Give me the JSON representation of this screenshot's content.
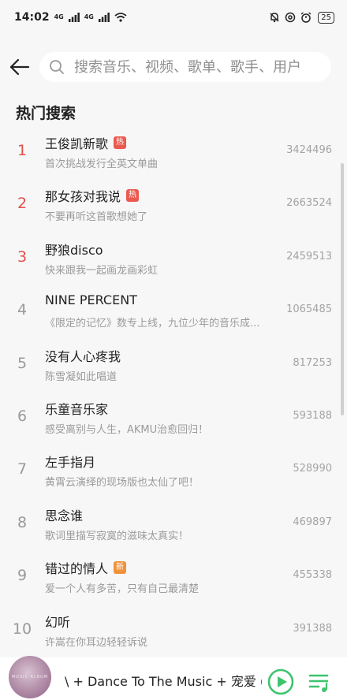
{
  "status_bar": {
    "time": "14:02",
    "signal1": "4G",
    "signal2": "4G",
    "battery": "25"
  },
  "search": {
    "placeholder": "搜索音乐、视频、歌单、歌手、用户"
  },
  "section_title": "热门搜索",
  "colors": {
    "accent": "#e0524a",
    "hot_badge": "#ea5a4f",
    "new_badge": "#f0923a",
    "play_green": "#3ec46d"
  },
  "hot_list": [
    {
      "rank": "1",
      "title": "王俊凯新歌",
      "badge": "热",
      "badge_type": "hot",
      "desc": "首次挑战发行全英文单曲",
      "count": "3424496"
    },
    {
      "rank": "2",
      "title": "那女孩对我说",
      "badge": "热",
      "badge_type": "hot",
      "desc": "不要再听这首歌想她了",
      "count": "2663524"
    },
    {
      "rank": "3",
      "title": "野狼disco",
      "badge": "",
      "badge_type": "",
      "desc": "快来跟我一起画龙画彩虹",
      "count": "2459513"
    },
    {
      "rank": "4",
      "title": "NINE PERCENT",
      "badge": "",
      "badge_type": "",
      "desc": "《限定的记忆》数专上线，九位少年的音乐成...",
      "count": "1065485"
    },
    {
      "rank": "5",
      "title": "没有人心疼我",
      "badge": "",
      "badge_type": "",
      "desc": "陈雪凝如此唱道",
      "count": "817253"
    },
    {
      "rank": "6",
      "title": "乐童音乐家",
      "badge": "",
      "badge_type": "",
      "desc": "感受离别与人生，AKMU治愈回归！",
      "count": "593188"
    },
    {
      "rank": "7",
      "title": "左手指月",
      "badge": "",
      "badge_type": "",
      "desc": "黄霄云演绎的现场版也太仙了吧！",
      "count": "528990"
    },
    {
      "rank": "8",
      "title": "思念谁",
      "badge": "",
      "badge_type": "",
      "desc": "歌词里描写寂寞的滋味太真实！",
      "count": "469897"
    },
    {
      "rank": "9",
      "title": "错过的情人",
      "badge": "新",
      "badge_type": "new",
      "desc": "爱一个人有多苦，只有自己最清楚",
      "count": "455338"
    },
    {
      "rank": "10",
      "title": "幻听",
      "badge": "",
      "badge_type": "",
      "desc": "许嵩在你耳边轻轻诉说",
      "count": "391388"
    }
  ],
  "player": {
    "cover_text": "MUSIC ALBUM",
    "now_playing": "\\ + Dance To The Music + 宠爱 (Live)"
  }
}
